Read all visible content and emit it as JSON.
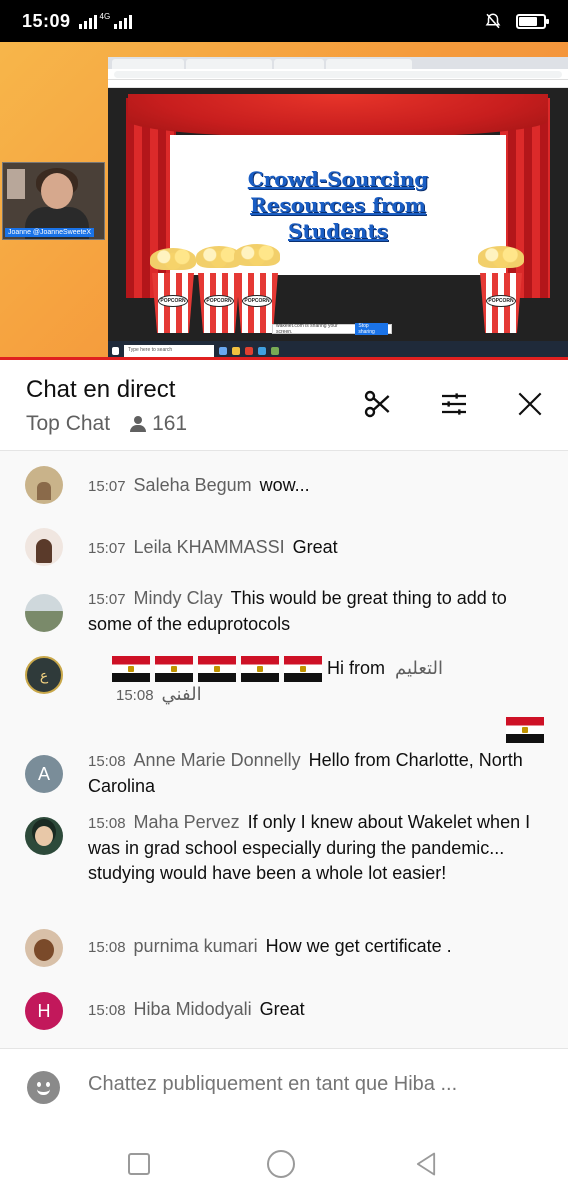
{
  "status_bar": {
    "time": "15:09",
    "network": "4G"
  },
  "video": {
    "webcam_tag": "Joanne @JoanneSweeteX",
    "slide_lines": [
      "Crowd-Sourcing",
      "Resources from",
      "Students"
    ],
    "popcorn_label": "POPCORN",
    "share_text": "wakelet.com is sharing your screen.",
    "share_stop": "Stop sharing",
    "taskbar_search": "Type here to search"
  },
  "chat_header": {
    "title": "Chat en direct",
    "mode": "Top Chat",
    "viewer_count": "161"
  },
  "messages": [
    {
      "time": "15:07",
      "author": "Saleha Begum",
      "text": "wow...",
      "avatar_color": "#c9b38a"
    },
    {
      "time": "15:07",
      "author": "Leila KHAMMASSI",
      "text": "Great",
      "avatar_color": "#f0e6e0"
    },
    {
      "time": "15:07",
      "author": "Mindy Clay",
      "text": "This would be great thing to add to some of the eduprotocols",
      "avatar_color": "#8a9a8a"
    },
    {
      "time": "15:08",
      "author": "التعليم الفني",
      "text": "Hi from",
      "avatar_color": "#2f3a3a"
    },
    {
      "time": "15:08",
      "author": "Anne Marie Donnelly",
      "text": "Hello from Charlotte, North Carolina",
      "avatar_letter": "A",
      "avatar_color": "#7a8d99"
    },
    {
      "time": "15:08",
      "author": "Maha Pervez",
      "text": "If only I knew about Wakelet when I was in grad school especially during the pandemic... studying would have been a whole lot easier!",
      "avatar_color": "#2d4a3a"
    },
    {
      "time": "15:08",
      "author": "purnima kumari",
      "text": "How we get certificate .",
      "avatar_color": "#8a5a3a"
    },
    {
      "time": "15:08",
      "author": "Hiba Midodyali",
      "text": "Great",
      "avatar_letter": "H",
      "avatar_color": "#c2185b"
    }
  ],
  "compose": {
    "placeholder": "Chattez publiquement en tant que Hiba ..."
  }
}
